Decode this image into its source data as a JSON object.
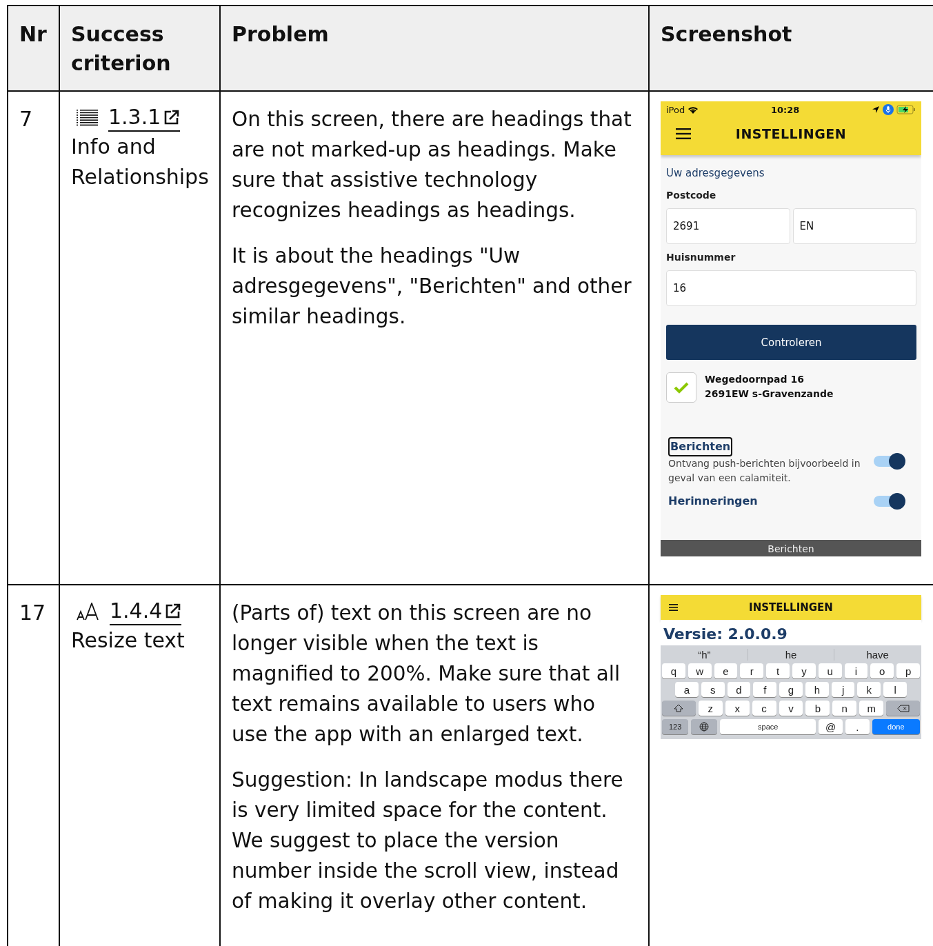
{
  "table": {
    "columns": [
      "Nr",
      "Success criterion",
      "Problem",
      "Screenshot"
    ],
    "rows": [
      {
        "nr": "7",
        "criterion": {
          "number": "1.3.1",
          "name": "Info and Relationships"
        },
        "problem": [
          "On this screen, there are headings that are not marked-up as headings. Make sure that assistive technology recognizes headings as headings.",
          "It is about the headings \"Uw adresgegevens\", \"Berichten\" and other similar headings."
        ],
        "screenshot": {
          "kind": "settings",
          "status_bar": {
            "carrier": "iPod",
            "time": "10:28"
          },
          "title": "INSTELLINGEN",
          "section": "Uw adresgegevens",
          "postcode_label": "Postcode",
          "postcode": [
            "2691",
            "EN"
          ],
          "house_label": "Huisnummer",
          "house": "16",
          "button": "Controleren",
          "address": {
            "checked": true,
            "lines": [
              "Wegedoornpad 16",
              "2691EW s-Gravenzande"
            ]
          },
          "settings": [
            {
              "title": "Berichten",
              "focused": true,
              "description": "Ontvang push-berichten bijvoorbeeld in geval van een calamiteit.",
              "on": true
            },
            {
              "title": "Herinneringen",
              "focused": false,
              "on": true
            }
          ],
          "tab_bar": "Berichten"
        }
      },
      {
        "nr": "17",
        "criterion": {
          "number": "1.4.4",
          "name": "Resize text"
        },
        "problem": [
          "(Parts of) text on this screen are no longer visible when the text is magnified to 200%. Make sure that all text remains available to users who use the app with an enlarged text.",
          "Suggestion: In landscape modus there is very limited space for the content. We suggest to place the version number inside the scroll view, instead of making it overlay other content."
        ],
        "screenshot": {
          "kind": "keyboard",
          "title": "INSTELLINGEN",
          "version": "Versie: 2.0.0.9",
          "suggestions": [
            "“h”",
            "he",
            "have"
          ],
          "keys": [
            [
              {
                "kind": "letter",
                "label": "q"
              },
              {
                "kind": "letter",
                "label": "w"
              },
              {
                "kind": "letter",
                "label": "e"
              },
              {
                "kind": "letter",
                "label": "r"
              },
              {
                "kind": "letter",
                "label": "t"
              },
              {
                "kind": "letter",
                "label": "y"
              },
              {
                "kind": "letter",
                "label": "u"
              },
              {
                "kind": "letter",
                "label": "i"
              },
              {
                "kind": "letter",
                "label": "o"
              },
              {
                "kind": "letter",
                "label": "p"
              }
            ],
            [
              {
                "kind": "letter",
                "label": "a"
              },
              {
                "kind": "letter",
                "label": "s"
              },
              {
                "kind": "letter",
                "label": "d"
              },
              {
                "kind": "letter",
                "label": "f"
              },
              {
                "kind": "letter",
                "label": "g"
              },
              {
                "kind": "letter",
                "label": "h"
              },
              {
                "kind": "letter",
                "label": "j"
              },
              {
                "kind": "letter",
                "label": "k"
              },
              {
                "kind": "letter",
                "label": "l"
              }
            ],
            [
              {
                "kind": "shift"
              },
              {
                "kind": "letter",
                "label": "z"
              },
              {
                "kind": "letter",
                "label": "x"
              },
              {
                "kind": "letter",
                "label": "c"
              },
              {
                "kind": "letter",
                "label": "v"
              },
              {
                "kind": "letter",
                "label": "b"
              },
              {
                "kind": "letter",
                "label": "n"
              },
              {
                "kind": "letter",
                "label": "m"
              },
              {
                "kind": "delete"
              }
            ],
            [
              {
                "kind": "mode",
                "label": "123"
              },
              {
                "kind": "globe"
              },
              {
                "kind": "space",
                "label": "space"
              },
              {
                "kind": "letter",
                "label": "@"
              },
              {
                "kind": "letter",
                "label": "."
              },
              {
                "kind": "done",
                "label": "done"
              }
            ]
          ]
        }
      }
    ]
  }
}
